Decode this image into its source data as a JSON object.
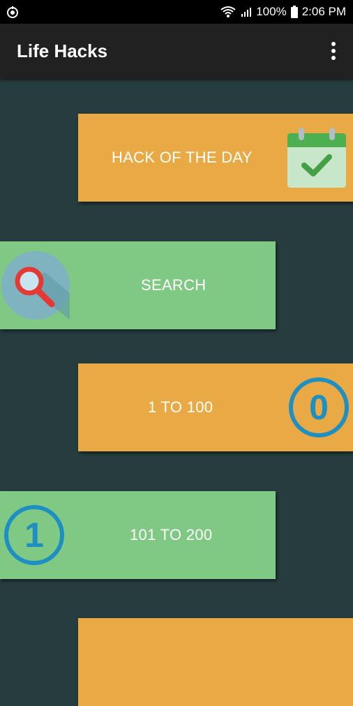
{
  "status": {
    "battery": "100%",
    "time": "2:06 PM"
  },
  "appbar": {
    "title": "Life Hacks",
    "menu_icon": "overflow-menu-icon"
  },
  "tiles": [
    {
      "label": "HACK OF THE DAY",
      "icon": "calendar-check-icon",
      "color": "#e9a944"
    },
    {
      "label": "SEARCH",
      "icon": "search-icon",
      "color": "#80c984"
    },
    {
      "label": "1 TO 100",
      "icon": "digit-zero-icon",
      "icon_text": "0",
      "color": "#e9a944"
    },
    {
      "label": "101 TO 200",
      "icon": "digit-one-icon",
      "icon_text": "1",
      "color": "#80c984"
    }
  ],
  "colors": {
    "background": "#263c3e",
    "appbar": "#212121",
    "orange": "#e9a944",
    "green": "#80c984",
    "ring": "#1e8fc2"
  }
}
